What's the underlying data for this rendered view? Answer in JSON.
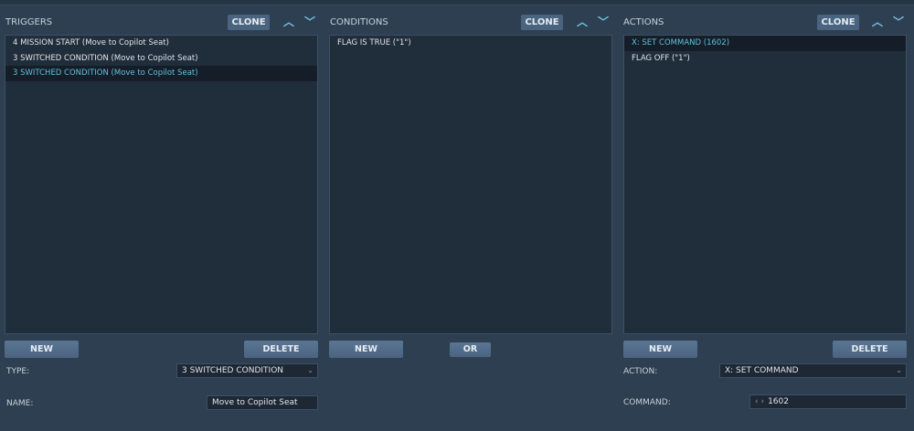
{
  "triggers": {
    "title": "TRIGGERS",
    "clone": "CLONE",
    "up": "^",
    "down": "v",
    "items": [
      "4 MISSION START (Move to Copilot Seat)",
      "3 SWITCHED CONDITION (Move to Copilot Seat)",
      "3 SWITCHED CONDITION (Move to Copilot Seat)"
    ],
    "selected_index": 2,
    "new": "NEW",
    "delete": "DELETE",
    "type_label": "TYPE:",
    "type_value": "3 SWITCHED CONDITION",
    "name_label": "NAME:",
    "name_value": "Move to Copilot Seat"
  },
  "conditions": {
    "title": "CONDITIONS",
    "clone": "CLONE",
    "items": [
      "FLAG IS TRUE (\"1\")"
    ],
    "new": "NEW",
    "or": "OR"
  },
  "actions": {
    "title": "ACTIONS",
    "clone": "CLONE",
    "items": [
      "X: SET COMMAND (1602)",
      "FLAG OFF (\"1\")"
    ],
    "selected_index": 0,
    "new": "NEW",
    "delete": "DELETE",
    "action_label": "ACTION:",
    "action_value": "X: SET COMMAND",
    "command_label": "COMMAND:",
    "command_value": "1602",
    "command_arrows": "‹ ›"
  }
}
